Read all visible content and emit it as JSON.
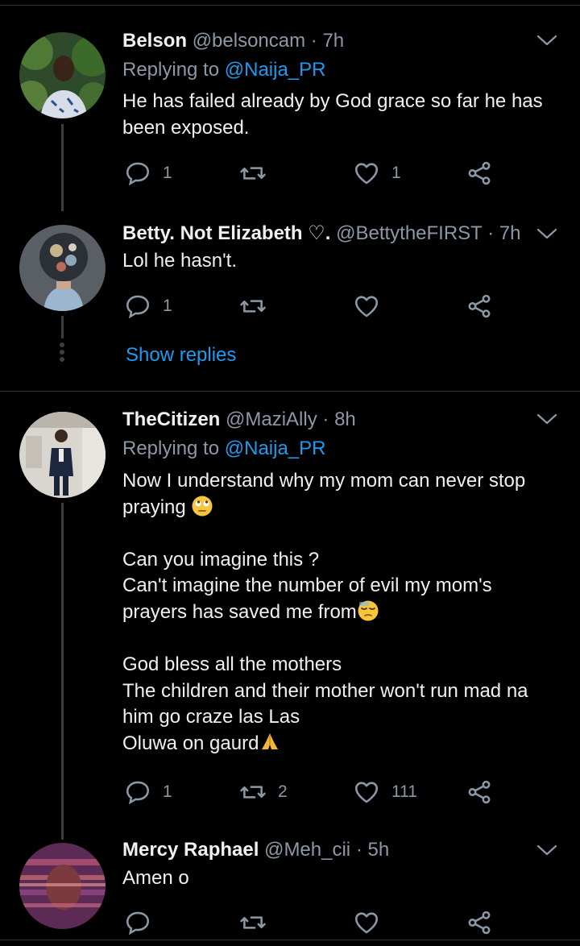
{
  "tweets": [
    {
      "name": "Belson",
      "handle": "@belsoncam",
      "time": "· 7h",
      "replying_prefix": "Replying to",
      "replying_to": "@Naija_PR",
      "lines": [
        "He has failed already by God grace so far he has",
        "been exposed."
      ],
      "replies": "1",
      "retweets": "",
      "likes": "1"
    },
    {
      "name": "Betty. Not Elizabeth ♡.",
      "handle": "@BettytheFIRST",
      "time": "· 7h",
      "lines": [
        "Lol he hasn't."
      ],
      "replies": "1",
      "retweets": "",
      "likes": ""
    },
    {
      "name": "TheCitizen",
      "handle": "@MaziAlly",
      "time": "· 8h",
      "replying_prefix": "Replying to",
      "replying_to": "@Naija_PR",
      "lines": [
        "Now I understand why my mom can never stop",
        "praying",
        "",
        "Can you imagine this ?",
        "Can't imagine the number of evil my mom's",
        "prayers has saved me from",
        "",
        "God bless all the mothers",
        "The children and their mother won't run mad na",
        "him go craze las Las",
        "Oluwa on gaurd"
      ],
      "replies": "1",
      "retweets": "2",
      "likes": "111"
    },
    {
      "name": "Mercy Raphael",
      "handle": "@Meh_cii",
      "time": "· 5h",
      "lines": [
        "Amen o"
      ],
      "replies": "",
      "retweets": "",
      "likes": ""
    }
  ],
  "show_replies": "Show replies",
  "icons": {
    "reply": "reply-icon",
    "retweet": "retweet-icon",
    "like": "heart-icon",
    "share": "share-icon",
    "menu": "chevron-down-icon"
  },
  "colors": {
    "background": "#000000",
    "accent": "#1d9bf0",
    "muted": "#8b98a5",
    "text": "#e8e8e8"
  }
}
